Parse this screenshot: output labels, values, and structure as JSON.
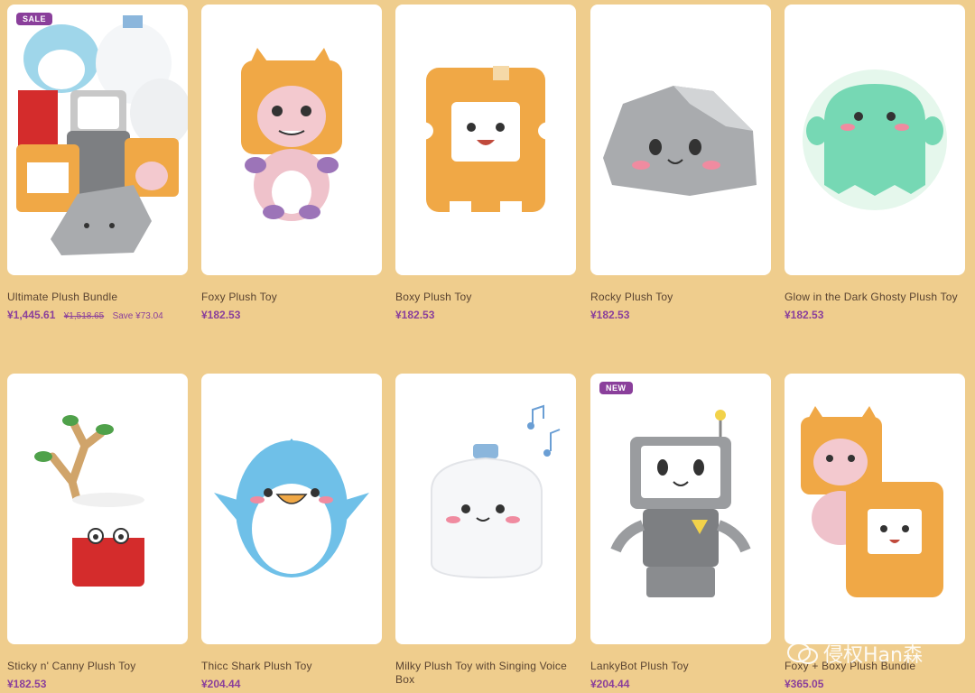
{
  "products": [
    {
      "title": "Ultimate Plush Bundle",
      "price": "¥1,445.61",
      "compare": "¥1,518.65",
      "save": "Save ¥73.04",
      "badge": "SALE"
    },
    {
      "title": "Foxy Plush Toy",
      "price": "¥182.53"
    },
    {
      "title": "Boxy Plush Toy",
      "price": "¥182.53"
    },
    {
      "title": "Rocky Plush Toy",
      "price": "¥182.53"
    },
    {
      "title": "Glow in the Dark Ghosty Plush Toy",
      "price": "¥182.53"
    },
    {
      "title": "Sticky n' Canny Plush Toy",
      "price": "¥182.53"
    },
    {
      "title": "Thicc Shark Plush Toy",
      "price": "¥204.44"
    },
    {
      "title": "Milky Plush Toy with Singing Voice Box",
      "price": ""
    },
    {
      "title": "LankyBot Plush Toy",
      "price": "¥204.44",
      "badge": "NEW"
    },
    {
      "title": "Foxy + Boxy Plush Bundle",
      "price": "¥365.05"
    }
  ],
  "watermark": "侵权Han森",
  "colors": {
    "background": "#efcd8d",
    "accent": "#8a3f9b",
    "text": "#5a4330"
  }
}
